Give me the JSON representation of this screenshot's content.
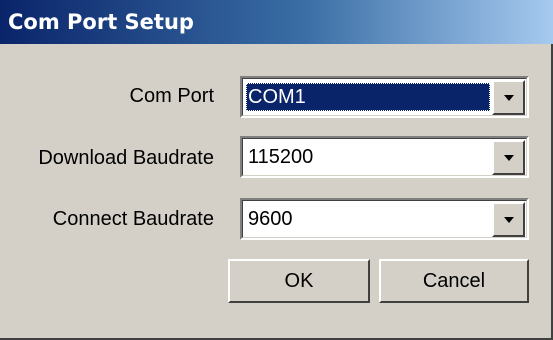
{
  "window": {
    "title": "Com Port Setup"
  },
  "fields": {
    "com_port": {
      "label": "Com Port",
      "value": "COM1",
      "selected": true
    },
    "download_baudrate": {
      "label": "Download Baudrate",
      "value": "115200"
    },
    "connect_baudrate": {
      "label": "Connect Baudrate",
      "value": "9600"
    }
  },
  "buttons": {
    "ok": "OK",
    "cancel": "Cancel"
  },
  "icons": {
    "dropdown": "chevron-down-icon"
  },
  "colors": {
    "title_start": "#0a246a",
    "title_end": "#a6caf0",
    "face": "#d4d0c8",
    "selection": "#0a246a"
  }
}
